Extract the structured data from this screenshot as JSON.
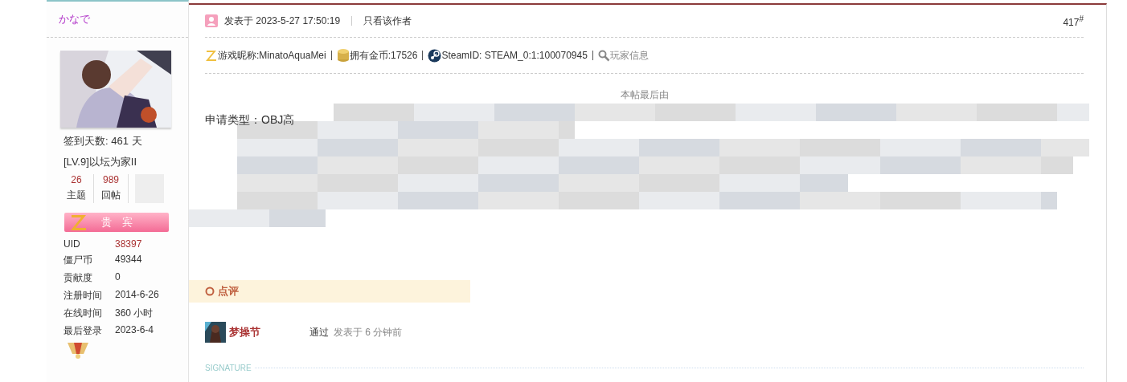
{
  "author": {
    "name": "かなで",
    "checkin": "签到天数: 461 天",
    "level": "[LV.9]以坛为家II",
    "stats": [
      {
        "value": "26",
        "label": "主题"
      },
      {
        "value": "989",
        "label": "回帖"
      }
    ],
    "group_badge": "贵　宾",
    "profile": [
      {
        "label": "UID",
        "value": "38397",
        "kind": "link"
      },
      {
        "label": "僵尸币",
        "value": "49344",
        "kind": "plain"
      },
      {
        "label": "贡献度",
        "value": "0",
        "kind": "plain"
      },
      {
        "label": "注册时间",
        "value": "2014-6-26",
        "kind": "plain"
      },
      {
        "label": "在线时间",
        "value": "360 小时",
        "kind": "plain"
      },
      {
        "label": "最后登录",
        "value": "2023-6-4",
        "kind": "plain"
      }
    ]
  },
  "post": {
    "posted": "发表于 2023-5-27 17:50:19",
    "author_only": "只看该作者",
    "floor": "417",
    "floor_mark": "#",
    "info": [
      {
        "kind": "z",
        "text": "游戏昵称:MinatoAquaMei"
      },
      {
        "kind": "coin",
        "text": "拥有金币:17526"
      },
      {
        "kind": "steam",
        "text": "SteamID: STEAM_0:1:100070945"
      },
      {
        "kind": "search",
        "text": "玩家信息"
      }
    ],
    "edit_note": "本帖最后由",
    "body_start": "申请类型：OBJ高",
    "comments_title": "点评",
    "comments": [
      {
        "user": "梦操节",
        "text": "通过",
        "time": "发表于 6 分钟前"
      }
    ],
    "signature_label": "SIGNATURE"
  }
}
